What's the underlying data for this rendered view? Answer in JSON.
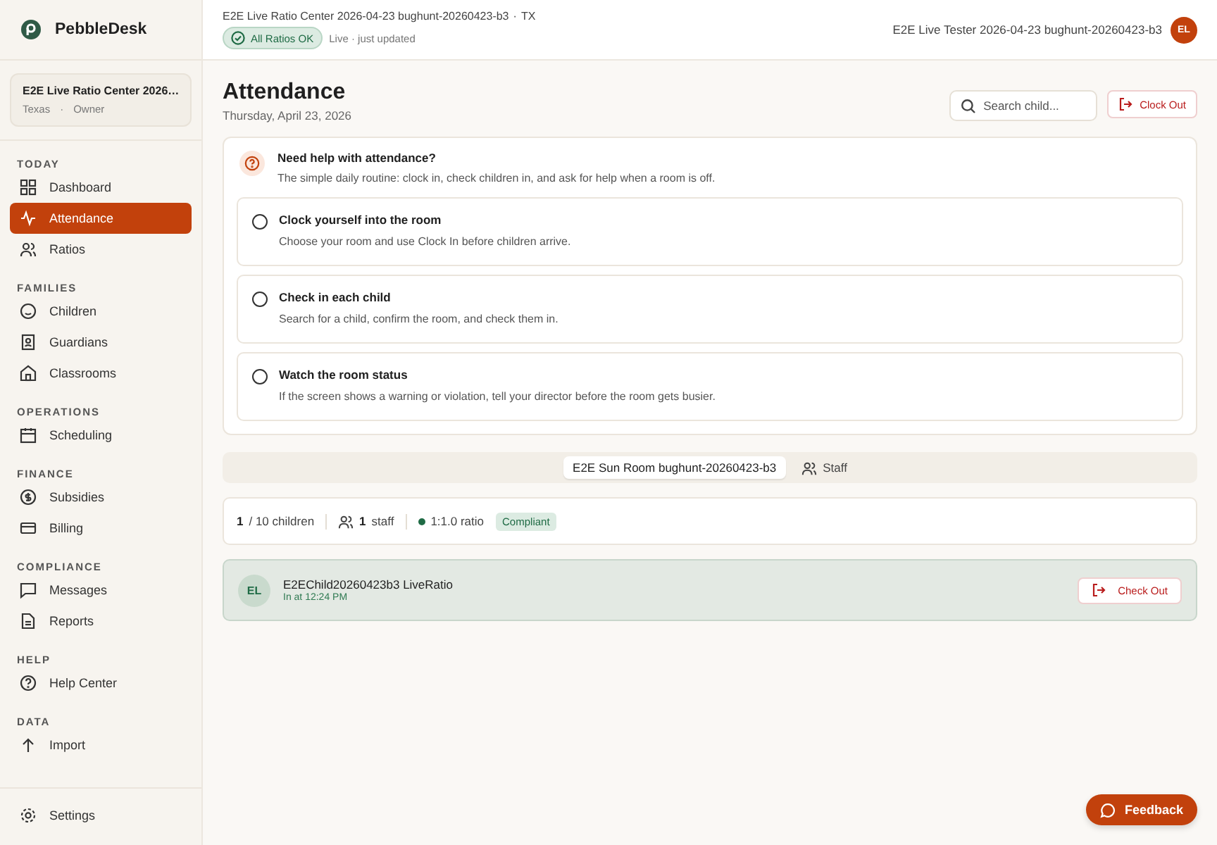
{
  "brand": {
    "name": "PebbleDesk"
  },
  "center": {
    "name": "E2E Live Ratio Center 2026…",
    "region": "Texas",
    "separator": "·",
    "role": "Owner"
  },
  "sidebar": {
    "sections": [
      {
        "title": "TODAY",
        "items": [
          {
            "label": "Dashboard",
            "selected": false
          },
          {
            "label": "Attendance",
            "selected": true
          },
          {
            "label": "Ratios",
            "selected": false
          }
        ]
      },
      {
        "title": "FAMILIES",
        "items": [
          {
            "label": "Children",
            "selected": false
          },
          {
            "label": "Guardians",
            "selected": false
          },
          {
            "label": "Classrooms",
            "selected": false
          }
        ]
      },
      {
        "title": "OPERATIONS",
        "items": [
          {
            "label": "Scheduling",
            "selected": false
          }
        ]
      },
      {
        "title": "FINANCE",
        "items": [
          {
            "label": "Subsidies",
            "selected": false
          },
          {
            "label": "Billing",
            "selected": false
          }
        ]
      },
      {
        "title": "COMPLIANCE",
        "items": [
          {
            "label": "Messages",
            "selected": false
          },
          {
            "label": "Reports",
            "selected": false
          }
        ]
      },
      {
        "title": "HELP",
        "items": [
          {
            "label": "Help Center",
            "selected": false
          }
        ]
      },
      {
        "title": "DATA",
        "items": [
          {
            "label": "Import",
            "selected": false
          }
        ]
      }
    ],
    "footer": {
      "label": "Settings"
    }
  },
  "topbar": {
    "center_name": "E2E Live Ratio Center 2026-04-23 bughunt-20260423-b3",
    "separator": "·",
    "state": "TX",
    "status_badge": "All Ratios OK",
    "live_text": "Live · just updated",
    "user_name": "E2E Live Tester 2026-04-23 bughunt-20260423-b3",
    "user_initials": "EL"
  },
  "page": {
    "title": "Attendance",
    "date": "Thursday, April 23, 2026",
    "search": {
      "placeholder": "Search child..."
    },
    "clock_out": "Clock Out"
  },
  "help": {
    "title": "Need help with attendance?",
    "subtitle": "The simple daily routine: clock in, check children in, and ask for help when a room is off.",
    "steps": [
      {
        "title": "Clock yourself into the room",
        "text": "Choose your room and use Clock In before children arrive.",
        "checked": false
      },
      {
        "title": "Check in each child",
        "text": "Search for a child, confirm the room, and check them in.",
        "checked": false
      },
      {
        "title": "Watch the room status",
        "text": "If the screen shows a warning or violation, tell your director before the room gets busier.",
        "checked": false
      }
    ]
  },
  "tabs": [
    {
      "label": "E2E Sun Room bughunt-20260423-b3",
      "kind": "room",
      "selected": true
    },
    {
      "label": "Staff",
      "kind": "staff",
      "selected": false
    }
  ],
  "stats": {
    "present": "1",
    "capacity": "/ 10 children",
    "staff_count": "1",
    "staff_label": "staff",
    "ratio": "1:1.0 ratio",
    "status": "Compliant"
  },
  "children": [
    {
      "initials": "EL",
      "name": "E2EChild20260423b3 LiveRatio",
      "time": "In at 12:24 PM",
      "action": "Check Out"
    }
  ],
  "feedback": "Feedback"
}
